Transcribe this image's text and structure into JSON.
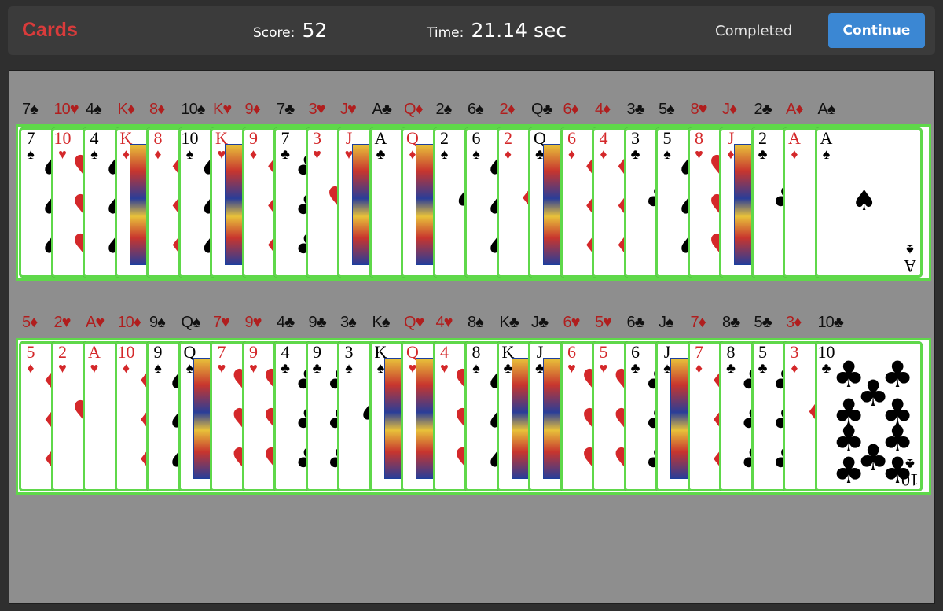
{
  "header": {
    "title": "Cards",
    "score_label": "Score:",
    "score_value": "52",
    "time_label": "Time:",
    "time_value": "21.14 sec",
    "status": "Completed",
    "continue_label": "Continue"
  },
  "colors": {
    "title_red": "#d83b3b",
    "button_blue": "#3b87d3",
    "highlight_green": "#5fd84a",
    "board_gray": "#8e8e8e"
  },
  "rows": [
    {
      "cards": [
        {
          "rank": "7",
          "suit": "♠"
        },
        {
          "rank": "10",
          "suit": "♥"
        },
        {
          "rank": "4",
          "suit": "♠"
        },
        {
          "rank": "K",
          "suit": "♦"
        },
        {
          "rank": "8",
          "suit": "♦"
        },
        {
          "rank": "10",
          "suit": "♠"
        },
        {
          "rank": "K",
          "suit": "♥"
        },
        {
          "rank": "9",
          "suit": "♦"
        },
        {
          "rank": "7",
          "suit": "♣"
        },
        {
          "rank": "3",
          "suit": "♥"
        },
        {
          "rank": "J",
          "suit": "♥"
        },
        {
          "rank": "A",
          "suit": "♣"
        },
        {
          "rank": "Q",
          "suit": "♦"
        },
        {
          "rank": "2",
          "suit": "♠"
        },
        {
          "rank": "6",
          "suit": "♠"
        },
        {
          "rank": "2",
          "suit": "♦"
        },
        {
          "rank": "Q",
          "suit": "♣"
        },
        {
          "rank": "6",
          "suit": "♦"
        },
        {
          "rank": "4",
          "suit": "♦"
        },
        {
          "rank": "3",
          "suit": "♣"
        },
        {
          "rank": "5",
          "suit": "♠"
        },
        {
          "rank": "8",
          "suit": "♥"
        },
        {
          "rank": "J",
          "suit": "♦"
        },
        {
          "rank": "2",
          "suit": "♣"
        },
        {
          "rank": "A",
          "suit": "♦"
        },
        {
          "rank": "A",
          "suit": "♠"
        }
      ]
    },
    {
      "cards": [
        {
          "rank": "5",
          "suit": "♦"
        },
        {
          "rank": "2",
          "suit": "♥"
        },
        {
          "rank": "A",
          "suit": "♥"
        },
        {
          "rank": "10",
          "suit": "♦"
        },
        {
          "rank": "9",
          "suit": "♠"
        },
        {
          "rank": "Q",
          "suit": "♠"
        },
        {
          "rank": "7",
          "suit": "♥"
        },
        {
          "rank": "9",
          "suit": "♥"
        },
        {
          "rank": "4",
          "suit": "♣"
        },
        {
          "rank": "9",
          "suit": "♣"
        },
        {
          "rank": "3",
          "suit": "♠"
        },
        {
          "rank": "K",
          "suit": "♠"
        },
        {
          "rank": "Q",
          "suit": "♥"
        },
        {
          "rank": "4",
          "suit": "♥"
        },
        {
          "rank": "8",
          "suit": "♠"
        },
        {
          "rank": "K",
          "suit": "♣"
        },
        {
          "rank": "J",
          "suit": "♣"
        },
        {
          "rank": "6",
          "suit": "♥"
        },
        {
          "rank": "5",
          "suit": "♥"
        },
        {
          "rank": "6",
          "suit": "♣"
        },
        {
          "rank": "J",
          "suit": "♠"
        },
        {
          "rank": "7",
          "suit": "♦"
        },
        {
          "rank": "8",
          "suit": "♣"
        },
        {
          "rank": "5",
          "suit": "♣"
        },
        {
          "rank": "3",
          "suit": "♦"
        },
        {
          "rank": "10",
          "suit": "♣"
        }
      ]
    }
  ]
}
